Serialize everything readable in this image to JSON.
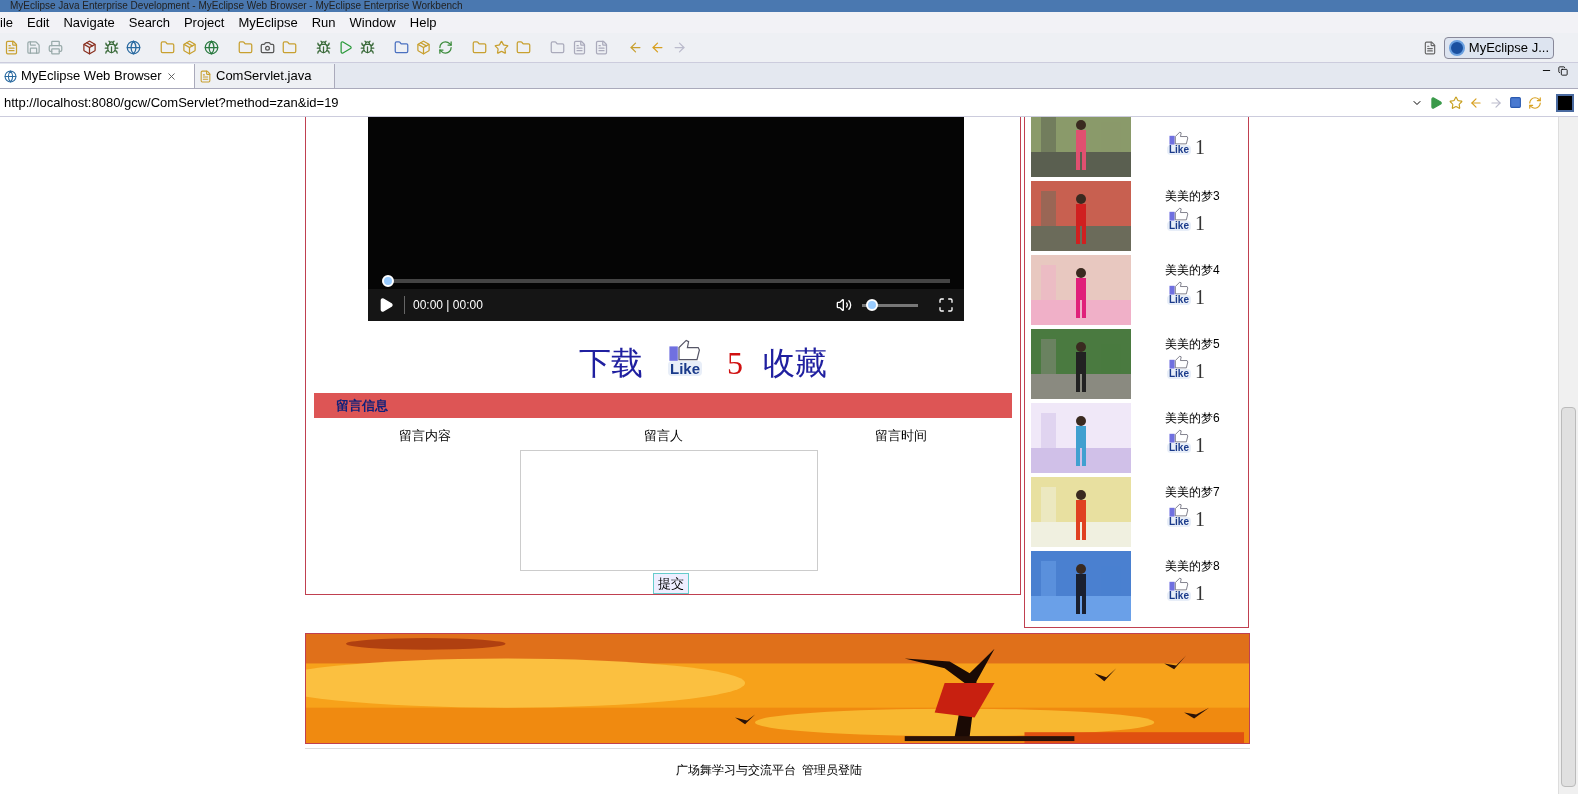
{
  "window": {
    "title": "MyEclipse Java Enterprise Development - MyEclipse Web Browser - MyEclipse Enterprise Workbench"
  },
  "menu": [
    "ile",
    "Edit",
    "Navigate",
    "Search",
    "Project",
    "MyEclipse",
    "Run",
    "Window",
    "Help"
  ],
  "perspective": {
    "label": "MyEclipse J..."
  },
  "tabs": [
    {
      "label": "MyEclipse Web Browser",
      "selected": true
    },
    {
      "label": "ComServlet.java",
      "selected": false
    }
  ],
  "address": {
    "value": "http://localhost:8080/gcw/ComServlet?method=zan&id=19"
  },
  "player": {
    "time": "00:00 | 00:00",
    "level": 0.0,
    "volume": {
      "level": 0.1
    }
  },
  "actions": {
    "download": "下载",
    "like_label": "Like",
    "likes": "5",
    "favorite": "收藏"
  },
  "comments": {
    "title": "留言信息",
    "columns": [
      "留言内容",
      "留言人",
      "留言时间"
    ],
    "submit": "提交"
  },
  "sidebar": [
    {
      "like_label": "Like",
      "likes": "1"
    },
    {
      "title": "美美的梦3",
      "like_label": "Like",
      "likes": "1"
    },
    {
      "title": "美美的梦4",
      "like_label": "Like",
      "likes": "1"
    },
    {
      "title": "美美的梦5",
      "like_label": "Like",
      "likes": "1"
    },
    {
      "title": "美美的梦6",
      "like_label": "Like",
      "likes": "1"
    },
    {
      "title": "美美的梦7",
      "like_label": "Like",
      "likes": "1"
    },
    {
      "title": "美美的梦8",
      "like_label": "Like",
      "likes": "1"
    }
  ],
  "footer": {
    "site": "广场舞学习与交流平台",
    "admin_link": "管理员登陆"
  }
}
